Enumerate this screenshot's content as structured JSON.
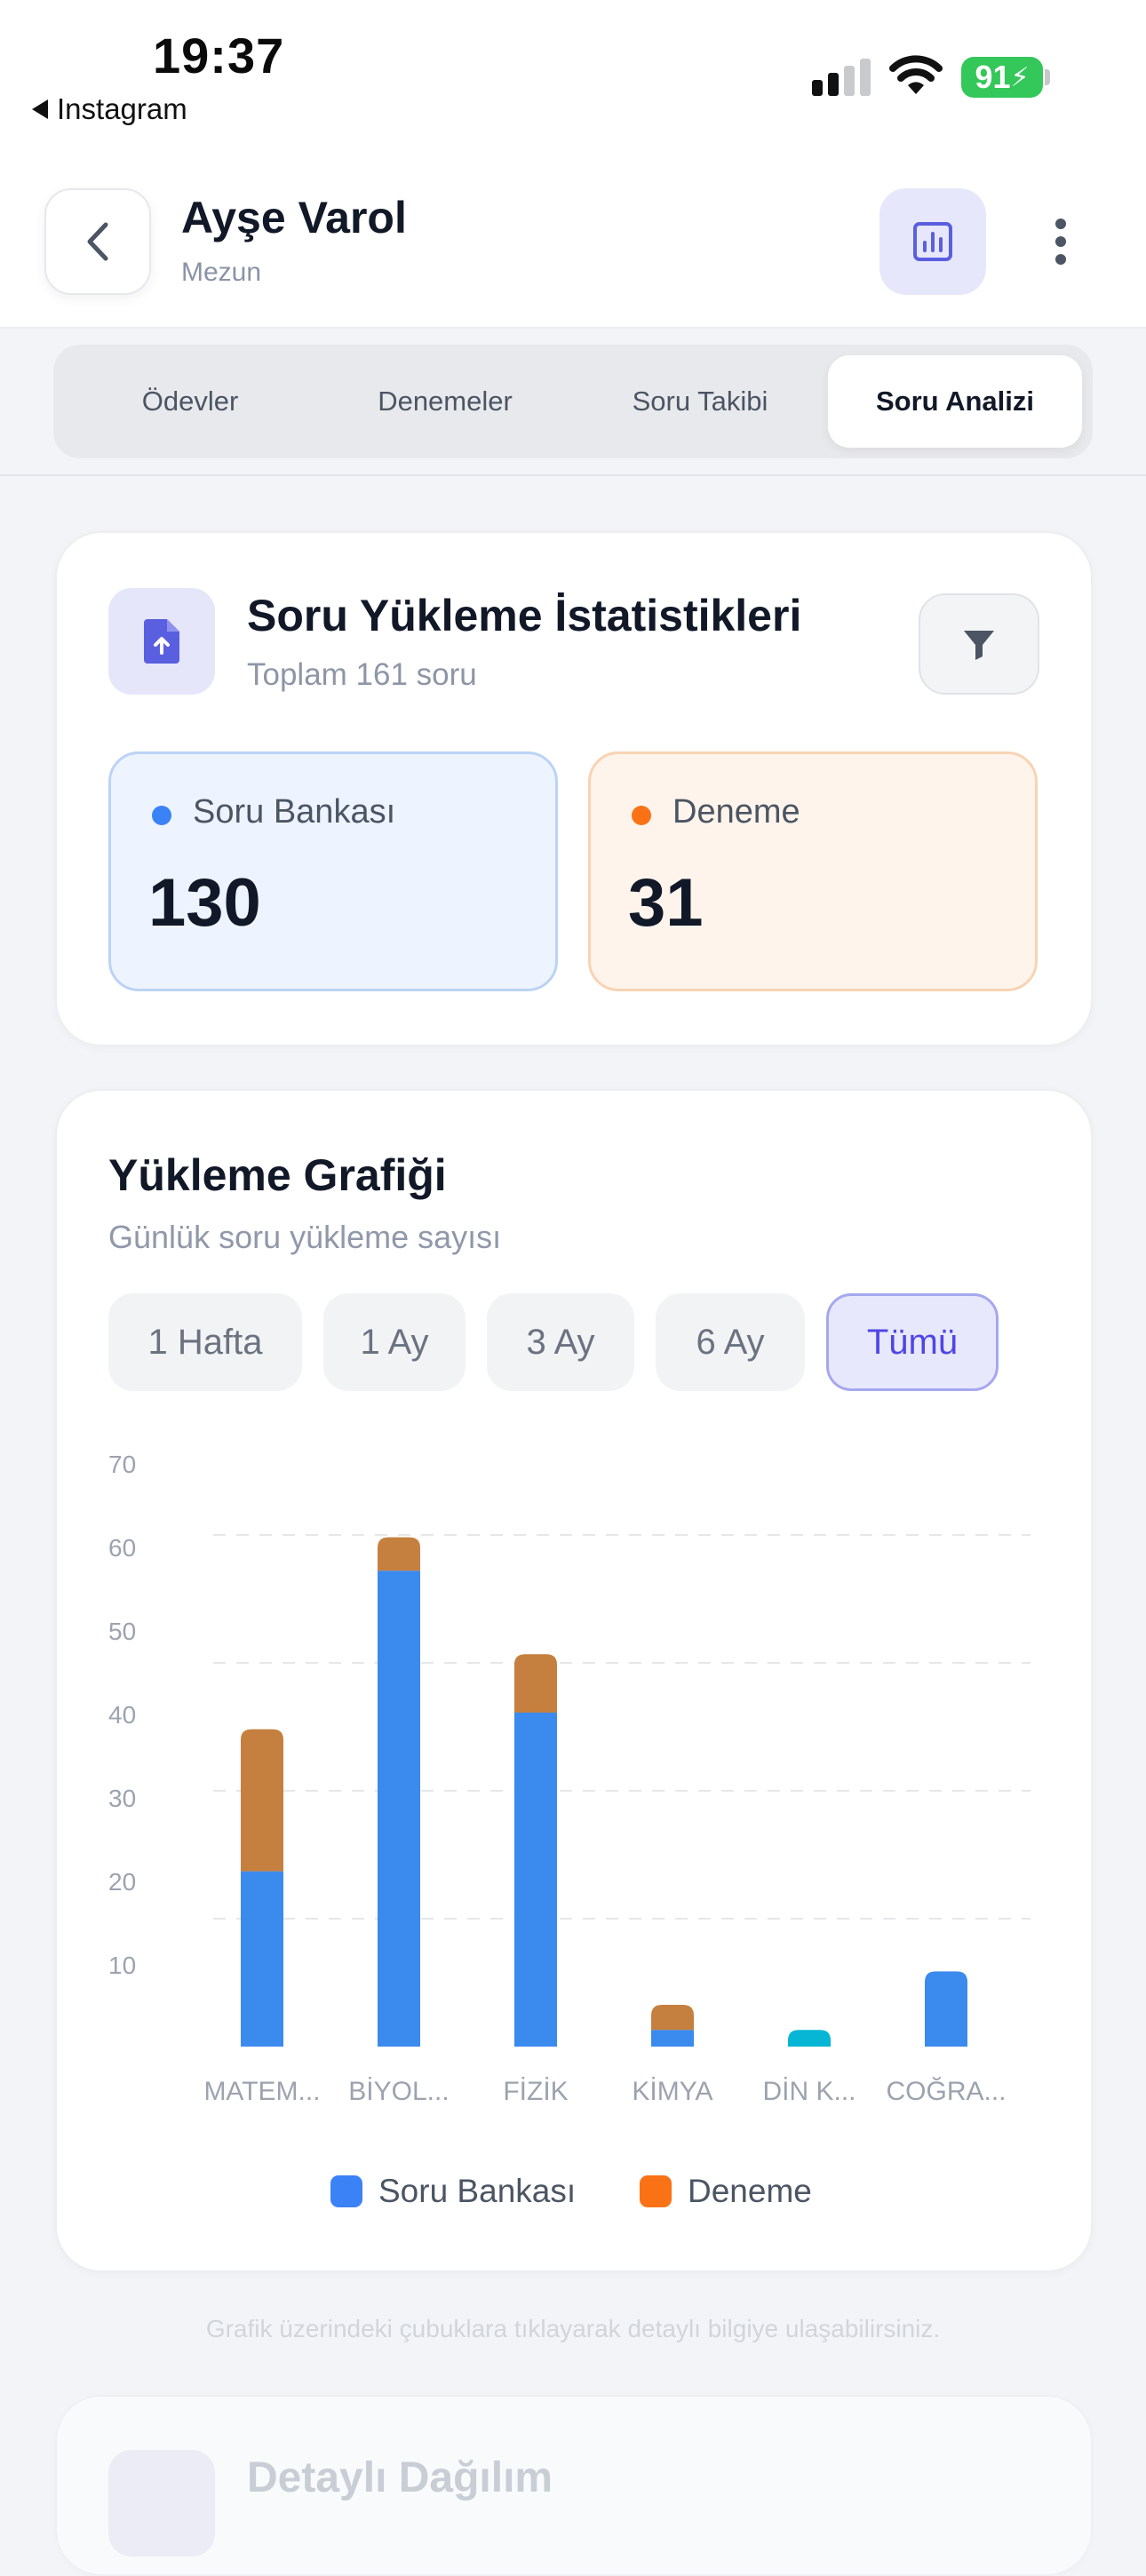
{
  "status_bar": {
    "time": "19:37",
    "back_app_label": "Instagram",
    "battery": "91",
    "icons": [
      "signal-icon",
      "wifi-icon",
      "battery-charging-icon"
    ]
  },
  "header": {
    "name": "Ayşe Varol",
    "role": "Mezun",
    "icons": [
      "chevron-left-icon",
      "chart-icon",
      "more-vertical-icon"
    ]
  },
  "tabs": [
    {
      "label": "Ödevler",
      "active": false
    },
    {
      "label": "Denemeler",
      "active": false
    },
    {
      "label": "Soru Takibi",
      "active": false
    },
    {
      "label": "Soru Analizi",
      "active": true
    }
  ],
  "upload_stats": {
    "title": "Soru Yükleme İstatistikleri",
    "subtitle": "Toplam 161 soru",
    "icon": "file-upload-icon",
    "filter_icon": "filter-icon",
    "soru_bankasi": {
      "label": "Soru Bankası",
      "value": "130",
      "color": "#3B82F6"
    },
    "deneme": {
      "label": "Deneme",
      "value": "31",
      "color": "#F97316"
    }
  },
  "chart_card": {
    "title": "Yükleme Grafiği",
    "subtitle": "Günlük soru yükleme sayısı",
    "ranges": [
      {
        "label": "1 Hafta",
        "active": false
      },
      {
        "label": "1 Ay",
        "active": false
      },
      {
        "label": "3 Ay",
        "active": false
      },
      {
        "label": "6 Ay",
        "active": false
      },
      {
        "label": "Tümü",
        "active": true
      }
    ],
    "legend": [
      {
        "label": "Soru Bankası",
        "color": "#3B82F6"
      },
      {
        "label": "Deneme",
        "color": "#F97316"
      }
    ]
  },
  "chart_data": {
    "type": "bar",
    "stacked": true,
    "categories": [
      "MATEM...",
      "BİYOL...",
      "FİZİK",
      "KİMYA",
      "DİN K...",
      "COĞRA..."
    ],
    "series": [
      {
        "name": "Soru Bankası",
        "values": [
          21,
          57,
          40,
          2,
          2,
          9
        ],
        "color": "#3B8AEE"
      },
      {
        "name": "Deneme",
        "values": [
          17,
          4,
          7,
          3,
          0,
          0
        ],
        "color": "#C5803F"
      }
    ],
    "yticks": [
      10,
      20,
      30,
      40,
      50,
      60,
      70
    ],
    "ylim": [
      0,
      70
    ],
    "grid": true
  },
  "hint": "Grafik üzerindeki çubuklara tıklayarak detaylı bilgiye ulaşabilirsiniz.",
  "next_card": {
    "title": "Detaylı Dağılım"
  }
}
